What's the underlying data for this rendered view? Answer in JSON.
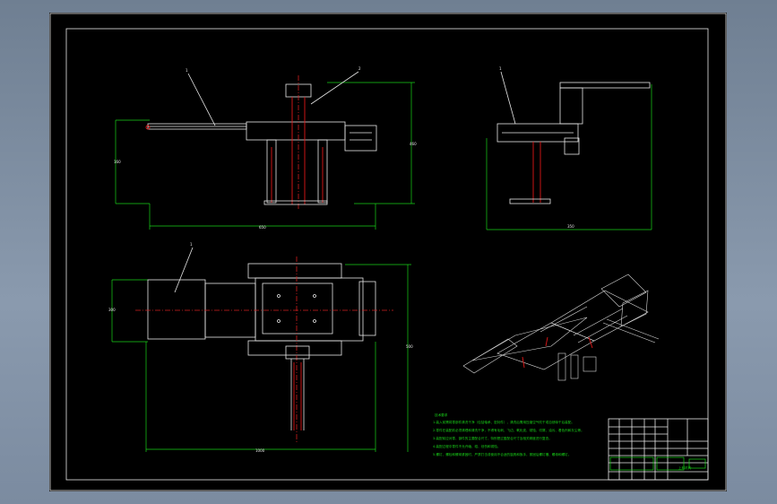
{
  "drawing": {
    "notes_heading": "技术要求",
    "notes": [
      "1.装入前需将零部件清洗干净（包括轴承、密封件），清洗后需用压缩空气吹干或自然晾干后装配。",
      "2.零件在装配前必须清理和清洗干净，不得有毛刺、飞边、氧化皮、锈蚀、切屑、油污、着色剂和灰尘等。",
      "3.装配前应对零、部件的主要配合尺寸，特别是过盈配合尺寸及相关精度进行复查。",
      "4.装配过程中零件不允许磕、碰、划伤和锈蚀。",
      "5.螺钉、螺栓和螺母紧固时，严禁打击或使用不合适的旋具和扳手，紧固后螺钉槽、螺母和螺钉。"
    ],
    "title_block_name": "上料机构",
    "balloon_top_view_left": "1",
    "balloon_top_view_right": "2",
    "balloon_side_view": "1",
    "balloon_plan_view": "1"
  }
}
